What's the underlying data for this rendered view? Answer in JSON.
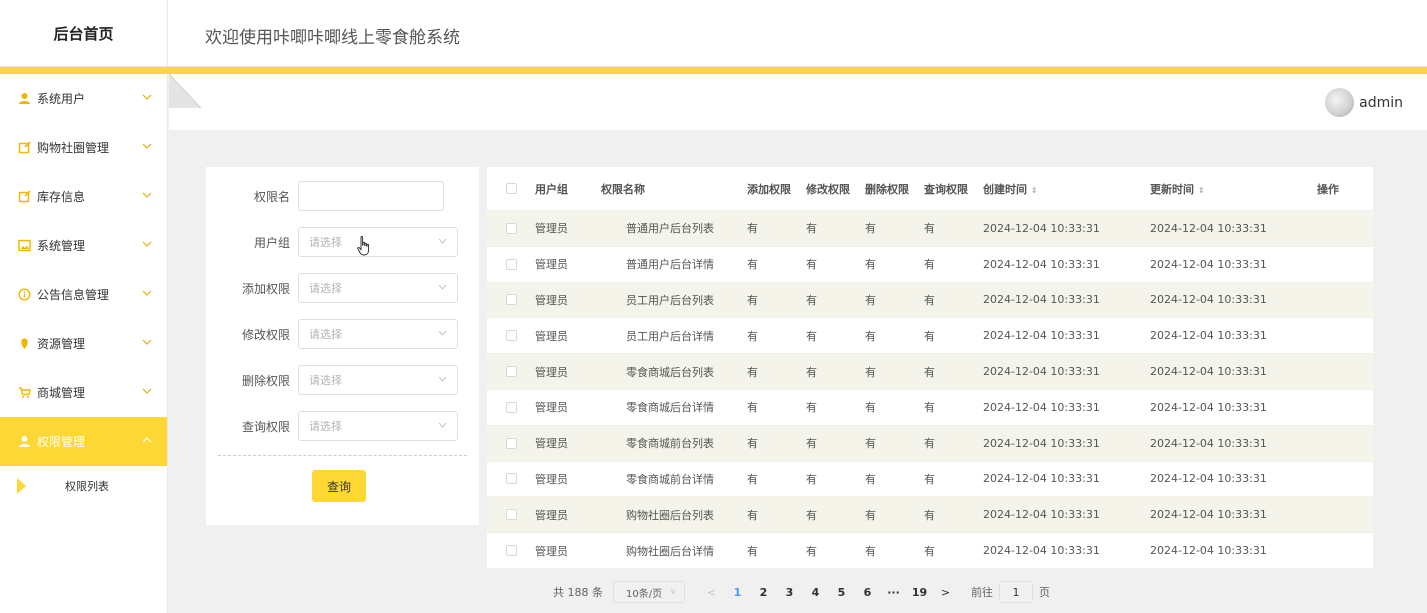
{
  "header": {
    "brand": "后台首页",
    "app_title": "欢迎使用咔唧咔唧线上零食舱系统"
  },
  "colors": {
    "accent": "#fdd835",
    "pager_active": "#409eff"
  },
  "sidebar": {
    "items": [
      {
        "label": "系统用户",
        "icon": "user-icon",
        "active": false
      },
      {
        "label": "购物社圈管理",
        "icon": "edit-icon",
        "active": false
      },
      {
        "label": "库存信息",
        "icon": "edit-icon",
        "active": false
      },
      {
        "label": "系统管理",
        "icon": "image-icon",
        "active": false
      },
      {
        "label": "公告信息管理",
        "icon": "info-icon",
        "active": false
      },
      {
        "label": "资源管理",
        "icon": "pin-icon",
        "active": false
      },
      {
        "label": "商城管理",
        "icon": "cart-icon",
        "active": false
      },
      {
        "label": "权限管理",
        "icon": "user-icon",
        "active": true
      }
    ],
    "subitem": "权限列表"
  },
  "user": {
    "name": "admin"
  },
  "filter": {
    "fields": [
      {
        "label": "权限名",
        "type": "input",
        "value": ""
      },
      {
        "label": "用户组",
        "type": "select",
        "placeholder": "请选择"
      },
      {
        "label": "添加权限",
        "type": "select",
        "placeholder": "请选择"
      },
      {
        "label": "修改权限",
        "type": "select",
        "placeholder": "请选择"
      },
      {
        "label": "删除权限",
        "type": "select",
        "placeholder": "请选择"
      },
      {
        "label": "查询权限",
        "type": "select",
        "placeholder": "请选择"
      }
    ],
    "search_label": "查询"
  },
  "table": {
    "headers": {
      "group": "用户组",
      "name": "权限名称",
      "add": "添加权限",
      "mod": "修改权限",
      "del": "删除权限",
      "qry": "查询权限",
      "created": "创建时间",
      "updated": "更新时间",
      "op": "操作"
    },
    "rows": [
      {
        "group": "管理员",
        "name": "普通用户后台列表",
        "add": "有",
        "mod": "有",
        "del": "有",
        "qry": "有",
        "created": "2024-12-04 10:33:31",
        "updated": "2024-12-04 10:33:31"
      },
      {
        "group": "管理员",
        "name": "普通用户后台详情",
        "add": "有",
        "mod": "有",
        "del": "有",
        "qry": "有",
        "created": "2024-12-04 10:33:31",
        "updated": "2024-12-04 10:33:31"
      },
      {
        "group": "管理员",
        "name": "员工用户后台列表",
        "add": "有",
        "mod": "有",
        "del": "有",
        "qry": "有",
        "created": "2024-12-04 10:33:31",
        "updated": "2024-12-04 10:33:31"
      },
      {
        "group": "管理员",
        "name": "员工用户后台详情",
        "add": "有",
        "mod": "有",
        "del": "有",
        "qry": "有",
        "created": "2024-12-04 10:33:31",
        "updated": "2024-12-04 10:33:31"
      },
      {
        "group": "管理员",
        "name": "零食商城后台列表",
        "add": "有",
        "mod": "有",
        "del": "有",
        "qry": "有",
        "created": "2024-12-04 10:33:31",
        "updated": "2024-12-04 10:33:31"
      },
      {
        "group": "管理员",
        "name": "零食商城后台详情",
        "add": "有",
        "mod": "有",
        "del": "有",
        "qry": "有",
        "created": "2024-12-04 10:33:31",
        "updated": "2024-12-04 10:33:31"
      },
      {
        "group": "管理员",
        "name": "零食商城前台列表",
        "add": "有",
        "mod": "有",
        "del": "有",
        "qry": "有",
        "created": "2024-12-04 10:33:31",
        "updated": "2024-12-04 10:33:31"
      },
      {
        "group": "管理员",
        "name": "零食商城前台详情",
        "add": "有",
        "mod": "有",
        "del": "有",
        "qry": "有",
        "created": "2024-12-04 10:33:31",
        "updated": "2024-12-04 10:33:31"
      },
      {
        "group": "管理员",
        "name": "购物社圈后台列表",
        "add": "有",
        "mod": "有",
        "del": "有",
        "qry": "有",
        "created": "2024-12-04 10:33:31",
        "updated": "2024-12-04 10:33:31"
      },
      {
        "group": "管理员",
        "name": "购物社圈后台详情",
        "add": "有",
        "mod": "有",
        "del": "有",
        "qry": "有",
        "created": "2024-12-04 10:33:31",
        "updated": "2024-12-04 10:33:31"
      }
    ]
  },
  "pagination": {
    "total": "共 188 条",
    "page_size": "10条/页",
    "prev": "<",
    "pages": [
      "1",
      "2",
      "3",
      "4",
      "5",
      "6",
      "···",
      "19"
    ],
    "current": "1",
    "next": ">",
    "jump_prefix": "前往",
    "jump_value": "1",
    "jump_suffix": "页"
  }
}
